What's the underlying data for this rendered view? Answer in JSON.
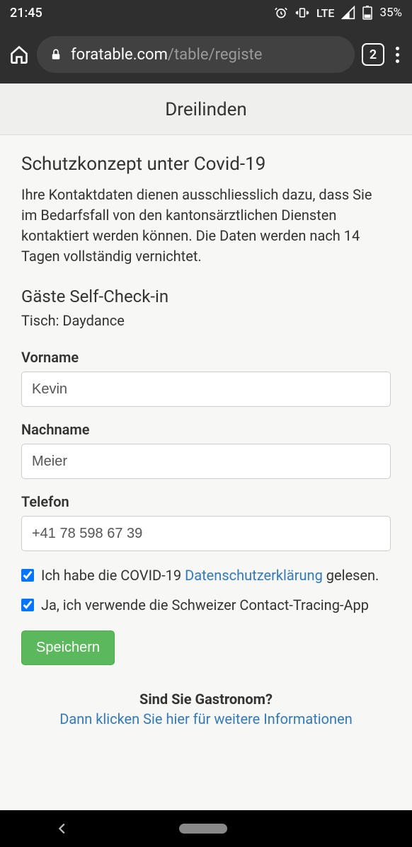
{
  "status": {
    "time": "21:45",
    "network": "LTE",
    "battery": "35%"
  },
  "browser": {
    "url_primary": "foratable.com",
    "url_path": "/table/registe",
    "tab_count": "2"
  },
  "page": {
    "header_title": "Dreilinden",
    "section_title": "Schutzkonzept unter Covid-19",
    "description": "Ihre Kontaktdaten dienen ausschliesslich dazu, dass Sie im Bedarfsfall von den kantonsärztlichen Diensten kontaktiert werden können. Die Daten werden nach 14 Tagen vollständig vernichtet.",
    "checkin_title": "Gäste Self-Check-in",
    "table_label": "Tisch: Daydance",
    "form": {
      "firstname_label": "Vorname",
      "firstname_value": "Kevin",
      "lastname_label": "Nachname",
      "lastname_value": "Meier",
      "phone_label": "Telefon",
      "phone_value": "+41 78 598 67 39",
      "consent1_prefix": "Ich habe die COVID-19 ",
      "consent1_link": "Datenschutzerklärung",
      "consent1_suffix": " gelesen.",
      "consent2": "Ja, ich verwende die Schweizer Contact-Tracing-App",
      "save_label": "Speichern"
    },
    "footer": {
      "question": "Sind Sie Gastronom?",
      "link": "Dann klicken Sie hier für weitere Informationen"
    }
  }
}
